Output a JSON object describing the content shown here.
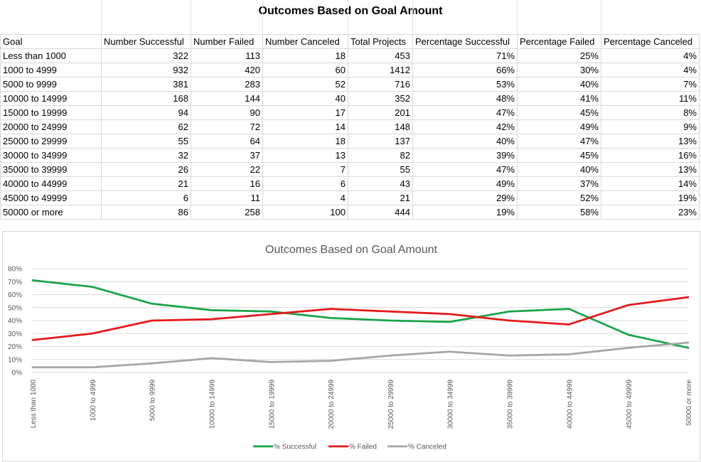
{
  "sheet": {
    "title": "Outcomes Based on Goal Amount",
    "headers": [
      "Goal",
      "Number Successful",
      "Number Failed",
      "Number Canceled",
      "Total Projects",
      "Percentage Successful",
      "Percentage Failed",
      "Percentage Canceled"
    ],
    "rows": [
      [
        "Less than 1000",
        "322",
        "113",
        "18",
        "453",
        "71%",
        "25%",
        "4%"
      ],
      [
        "1000 to 4999",
        "932",
        "420",
        "60",
        "1412",
        "66%",
        "30%",
        "4%"
      ],
      [
        "5000 to 9999",
        "381",
        "283",
        "52",
        "716",
        "53%",
        "40%",
        "7%"
      ],
      [
        "10000 to 14999",
        "168",
        "144",
        "40",
        "352",
        "48%",
        "41%",
        "11%"
      ],
      [
        "15000 to 19999",
        "94",
        "90",
        "17",
        "201",
        "47%",
        "45%",
        "8%"
      ],
      [
        "20000 to 24999",
        "62",
        "72",
        "14",
        "148",
        "42%",
        "49%",
        "9%"
      ],
      [
        "25000 to 29999",
        "55",
        "64",
        "18",
        "137",
        "40%",
        "47%",
        "13%"
      ],
      [
        "30000 to 34999",
        "32",
        "37",
        "13",
        "82",
        "39%",
        "45%",
        "16%"
      ],
      [
        "35000 to 39999",
        "26",
        "22",
        "7",
        "55",
        "47%",
        "40%",
        "13%"
      ],
      [
        "40000 to 44999",
        "21",
        "16",
        "6",
        "43",
        "49%",
        "37%",
        "14%"
      ],
      [
        "45000 to 49999",
        "6",
        "11",
        "4",
        "21",
        "29%",
        "52%",
        "19%"
      ],
      [
        "50000 or more",
        "86",
        "258",
        "100",
        "444",
        "19%",
        "58%",
        "23%"
      ]
    ]
  },
  "chart_data": {
    "type": "line",
    "title": "Outcomes Based on Goal Amount",
    "categories": [
      "Less than 1000",
      "1000 to 4999",
      "5000 to 9999",
      "10000 to 14999",
      "15000 to 19999",
      "20000 to 24999",
      "25000 to 29999",
      "30000 to 34999",
      "35000 to 39999",
      "40000 to 44999",
      "45000 to 49999",
      "50000 or more"
    ],
    "yticks": [
      "0%",
      "10%",
      "20%",
      "30%",
      "40%",
      "50%",
      "60%",
      "70%",
      "80%"
    ],
    "ylim": [
      0,
      80
    ],
    "grid": true,
    "legend_position": "bottom",
    "series": [
      {
        "name": "% Successful",
        "color": "#1aa34a",
        "values": [
          71,
          66,
          53,
          48,
          47,
          42,
          40,
          39,
          47,
          49,
          29,
          19
        ]
      },
      {
        "name": "% Failed",
        "color": "#e3191b",
        "values": [
          25,
          30,
          40,
          41,
          45,
          49,
          47,
          45,
          40,
          37,
          52,
          58
        ]
      },
      {
        "name": "% Canceled",
        "color": "#a5a5a5",
        "values": [
          4,
          4,
          7,
          11,
          8,
          9,
          13,
          16,
          13,
          14,
          19,
          23
        ]
      }
    ]
  }
}
